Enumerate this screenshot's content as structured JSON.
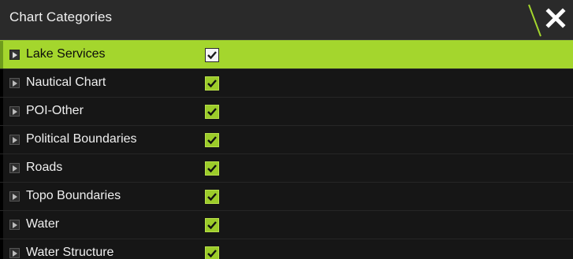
{
  "dialog": {
    "title": "Chart Categories",
    "close_icon": "close-icon"
  },
  "colors": {
    "accent": "#a4d62d",
    "titlebar": "#2a2a2a",
    "row_bg": "#161616"
  },
  "categories": [
    {
      "label": "Lake Services",
      "checked": true,
      "selected": true
    },
    {
      "label": "Nautical Chart",
      "checked": true,
      "selected": false
    },
    {
      "label": "POI-Other",
      "checked": true,
      "selected": false
    },
    {
      "label": "Political Boundaries",
      "checked": true,
      "selected": false
    },
    {
      "label": "Roads",
      "checked": true,
      "selected": false
    },
    {
      "label": "Topo Boundaries",
      "checked": true,
      "selected": false
    },
    {
      "label": "Water",
      "checked": true,
      "selected": false
    },
    {
      "label": "Water Structure",
      "checked": true,
      "selected": false
    }
  ]
}
